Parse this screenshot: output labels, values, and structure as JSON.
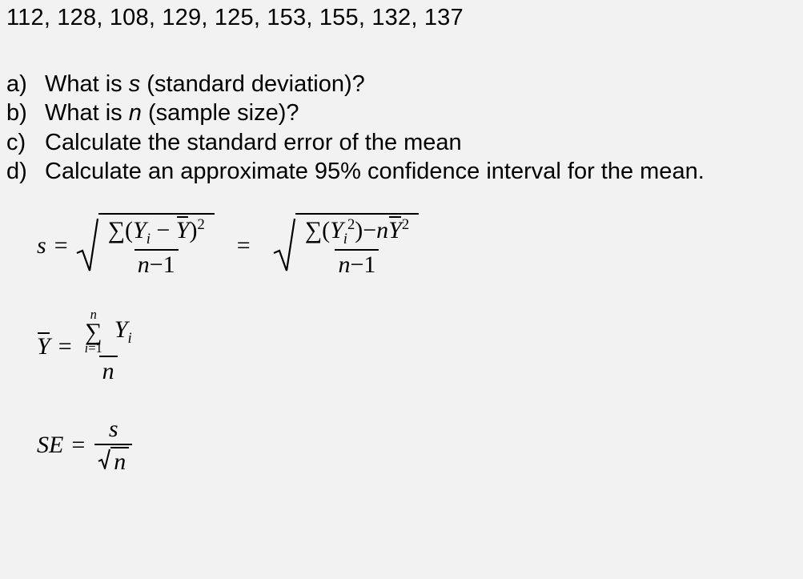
{
  "data_values": "112, 128, 108, 129, 125, 153, 155, 132, 137",
  "questions": {
    "a": {
      "label": "a)",
      "prefix": "What is ",
      "var": "s",
      "suffix": " (standard deviation)?"
    },
    "b": {
      "label": "b)",
      "prefix": "What is ",
      "var": "n",
      "suffix": " (sample size)?"
    },
    "c": {
      "label": "c)",
      "text": "Calculate the standard error of the mean"
    },
    "d": {
      "label": "d)",
      "text": "Calculate an approximate 95% confidence interval for the mean."
    }
  },
  "formulas": {
    "s": {
      "lhs": "s",
      "eq": "=",
      "num1_a": "∑(",
      "num1_b": "Y",
      "num1_sub": "i",
      "num1_c": " − ",
      "num1_d": "Y",
      "num1_e": ")",
      "num1_sup": "2",
      "den1_a": "n",
      "den1_b": "−1",
      "eq2": "=",
      "num2_a": "∑(",
      "num2_b": "Y",
      "num2_sub": "i",
      "num2_sup": "2",
      "num2_c": ")−",
      "num2_d": "n",
      "num2_e": "Y",
      "num2_sup2": "2",
      "den2_a": "n",
      "den2_b": "−1"
    },
    "ybar": {
      "lhs": "Y",
      "eq": "=",
      "sum_top": "n",
      "sum_bot_a": "i",
      "sum_bot_b": "=1",
      "yi_a": "Y",
      "yi_sub": "i",
      "den": "n"
    },
    "se": {
      "lhs": "SE",
      "eq": "=",
      "num": "s",
      "den": "n"
    }
  }
}
